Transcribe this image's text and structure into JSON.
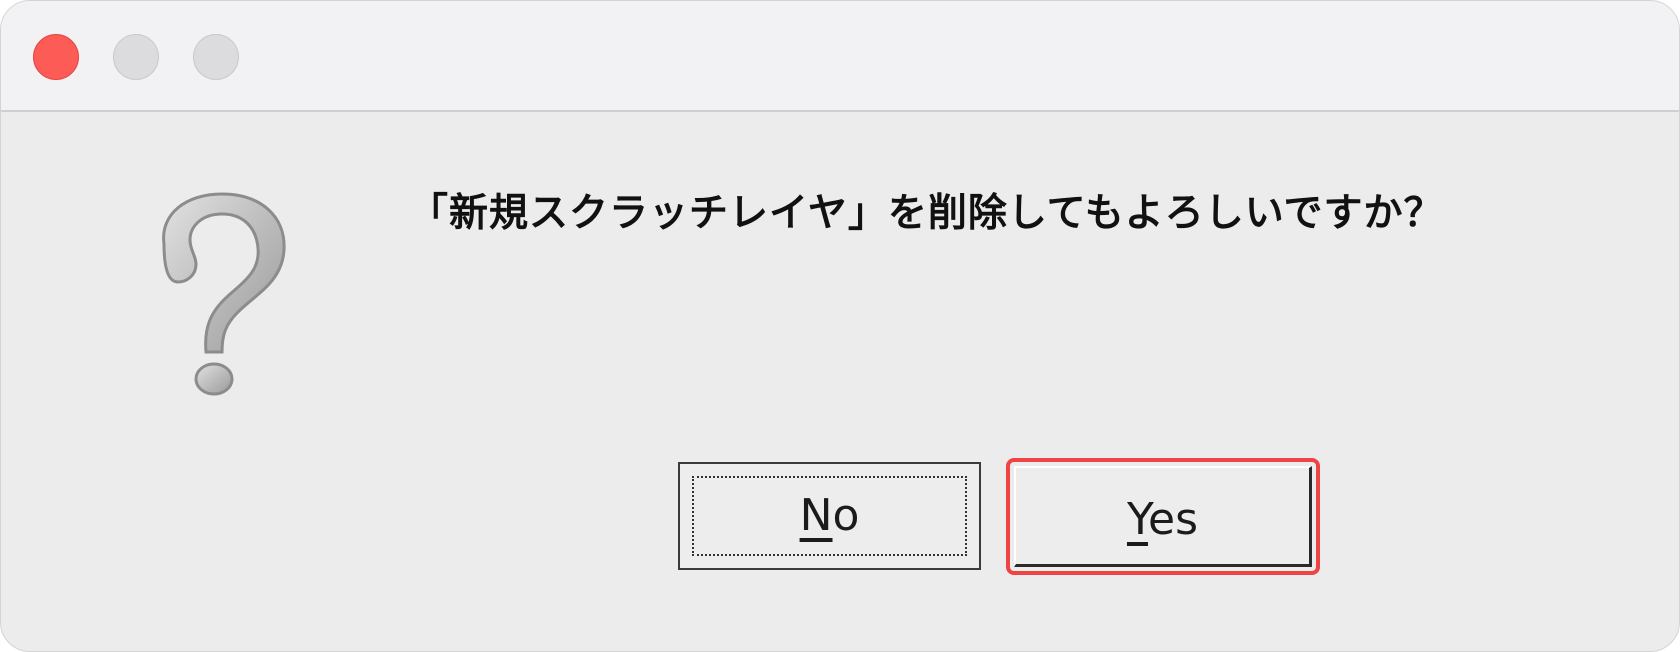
{
  "dialog": {
    "message": "「新規スクラッチレイヤ」を削除してもよろしいですか？",
    "icon": "question-mark-icon"
  },
  "window_controls": {
    "close": "close-traffic-light",
    "minimize": "minimize-traffic-light",
    "maximize": "maximize-traffic-light"
  },
  "buttons": {
    "no": {
      "mnemonic": "N",
      "rest": "o"
    },
    "yes": {
      "mnemonic": "Y",
      "rest": "es"
    }
  },
  "colors": {
    "close": "#fd5b55",
    "highlight": "#ef4444",
    "background": "#ececec"
  }
}
